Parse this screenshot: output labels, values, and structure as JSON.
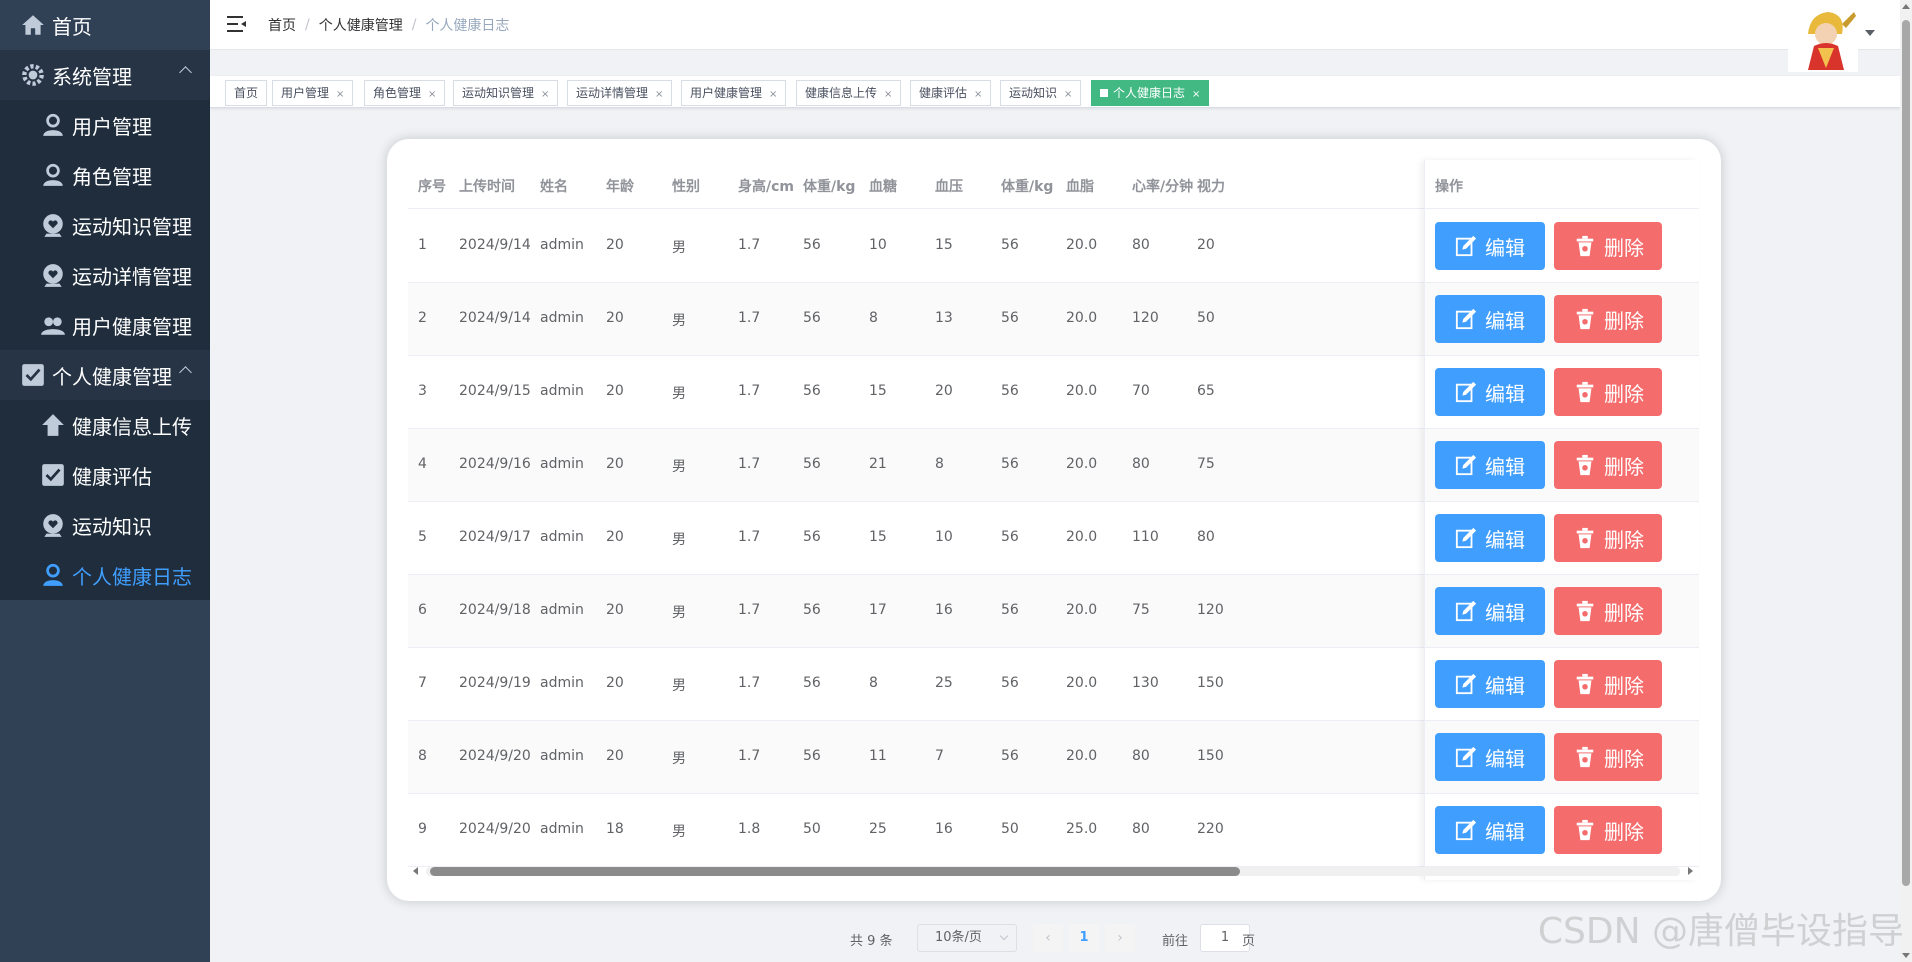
{
  "sidebar": {
    "home": "首页",
    "system": {
      "label": "系统管理",
      "items": [
        "用户管理",
        "角色管理",
        "运动知识管理",
        "运动详情管理",
        "用户健康管理"
      ]
    },
    "personal": {
      "label": "个人健康管理",
      "items": [
        "健康信息上传",
        "健康评估",
        "运动知识",
        "个人健康日志"
      ]
    }
  },
  "breadcrumb": [
    "首页",
    "个人健康管理",
    "个人健康日志"
  ],
  "tags": [
    "首页",
    "用户管理",
    "角色管理",
    "运动知识管理",
    "运动详情管理",
    "用户健康管理",
    "健康信息上传",
    "健康评估",
    "运动知识",
    "个人健康日志"
  ],
  "tag_close": "×",
  "table": {
    "headers": [
      "序号",
      "上传时间",
      "姓名",
      "年龄",
      "性别",
      "身高/cm",
      "体重/kg",
      "血糖",
      "血压",
      "体重/kg",
      "血脂",
      "心率/分钟",
      "视力",
      "操作"
    ],
    "rows": [
      [
        "1",
        "2024/9/14",
        "admin",
        "20",
        "男",
        "1.7",
        "56",
        "10",
        "15",
        "56",
        "20.0",
        "80",
        "20"
      ],
      [
        "2",
        "2024/9/14",
        "admin",
        "20",
        "男",
        "1.7",
        "56",
        "8",
        "13",
        "56",
        "20.0",
        "120",
        "50"
      ],
      [
        "3",
        "2024/9/15",
        "admin",
        "20",
        "男",
        "1.7",
        "56",
        "15",
        "20",
        "56",
        "20.0",
        "70",
        "65"
      ],
      [
        "4",
        "2024/9/16",
        "admin",
        "20",
        "男",
        "1.7",
        "56",
        "21",
        "8",
        "56",
        "20.0",
        "80",
        "75"
      ],
      [
        "5",
        "2024/9/17",
        "admin",
        "20",
        "男",
        "1.7",
        "56",
        "15",
        "10",
        "56",
        "20.0",
        "110",
        "80"
      ],
      [
        "6",
        "2024/9/18",
        "admin",
        "20",
        "男",
        "1.7",
        "56",
        "17",
        "16",
        "56",
        "20.0",
        "75",
        "120"
      ],
      [
        "7",
        "2024/9/19",
        "admin",
        "20",
        "男",
        "1.7",
        "56",
        "8",
        "25",
        "56",
        "20.0",
        "130",
        "150"
      ],
      [
        "8",
        "2024/9/20",
        "admin",
        "20",
        "男",
        "1.7",
        "56",
        "11",
        "7",
        "56",
        "20.0",
        "80",
        "150"
      ],
      [
        "9",
        "2024/9/20",
        "admin",
        "18",
        "男",
        "1.8",
        "50",
        "25",
        "16",
        "50",
        "25.0",
        "80",
        "220"
      ]
    ],
    "edit_label": "编辑",
    "delete_label": "删除"
  },
  "pagination": {
    "total": "共 9 条",
    "page_size": "10条/页",
    "current_page": "1",
    "goto_label": "前往",
    "goto_value": "1",
    "page_unit": "页",
    "prev": "‹",
    "next": "›"
  },
  "watermark": "CSDN @唐僧毕设指导",
  "colors": {
    "sidebar_bg": "#304156",
    "submenu_bg": "#1f2d3d",
    "active_menu": "#409eff",
    "edit_button": "#409eff",
    "delete_button": "#f56c6c",
    "active_tag": "#42b983"
  },
  "icons": {
    "home": "home-icon",
    "system": "gear-icon",
    "user": "user-icon",
    "heart": "heart-icon",
    "group": "users-icon",
    "check": "checkbox-icon",
    "upload": "upload-icon",
    "edit": "edit-icon",
    "delete": "trash-icon"
  }
}
